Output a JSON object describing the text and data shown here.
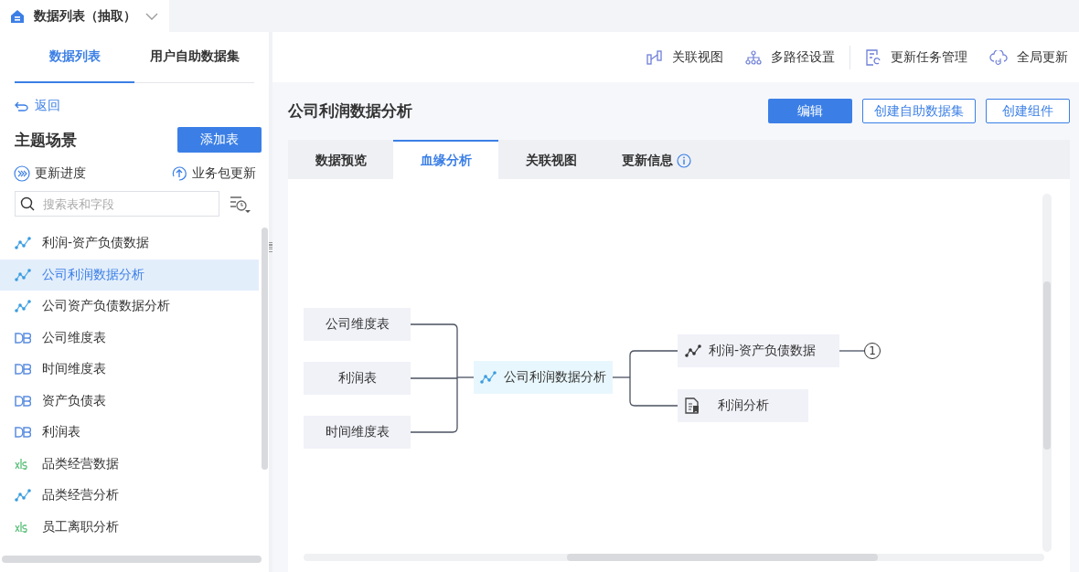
{
  "top_tab": {
    "title": "数据列表（抽取）"
  },
  "sidebar_tabs": [
    {
      "label": "数据列表",
      "selected": true
    },
    {
      "label": "用户自助数据集",
      "selected": false
    }
  ],
  "back": "返回",
  "section_title": "主题场景",
  "add_button": "添加表",
  "update_progress": "更新进度",
  "package_update": "业务包更新",
  "search": {
    "placeholder": "搜索表和字段"
  },
  "items": [
    {
      "label": "利润-资产负债数据",
      "kind": "model",
      "selected": false
    },
    {
      "label": "公司利润数据分析",
      "kind": "model",
      "selected": true
    },
    {
      "label": "公司资产负债数据分析",
      "kind": "model",
      "selected": false
    },
    {
      "label": "公司维度表",
      "kind": "db",
      "selected": false
    },
    {
      "label": "时间维度表",
      "kind": "db",
      "selected": false
    },
    {
      "label": "资产负债表",
      "kind": "db",
      "selected": false
    },
    {
      "label": "利润表",
      "kind": "db",
      "selected": false
    },
    {
      "label": "品类经营数据",
      "kind": "xls",
      "selected": false
    },
    {
      "label": "品类经营分析",
      "kind": "model",
      "selected": false
    },
    {
      "label": "员工离职分析",
      "kind": "xls",
      "selected": false
    }
  ],
  "toolbar": [
    {
      "label": "关联视图",
      "kind": "relation"
    },
    {
      "label": "多路径设置",
      "kind": "tree"
    },
    {
      "label": "更新任务管理",
      "kind": "task"
    },
    {
      "label": "全局更新",
      "kind": "cloud"
    }
  ],
  "page_title": "公司利润数据分析",
  "actions": [
    {
      "label": "编辑",
      "kind": "primary"
    },
    {
      "label": "创建自助数据集",
      "kind": "outline"
    },
    {
      "label": "创建组件",
      "kind": "outline"
    }
  ],
  "content_tabs": [
    {
      "label": "数据预览",
      "selected": false,
      "info": false
    },
    {
      "label": "血缘分析",
      "selected": true,
      "info": false
    },
    {
      "label": "关联视图",
      "selected": false,
      "info": false
    },
    {
      "label": "更新信息",
      "selected": false,
      "info": true
    }
  ],
  "lineage": {
    "sources": [
      {
        "label": "公司维度表"
      },
      {
        "label": "利润表"
      },
      {
        "label": "时间维度表"
      }
    ],
    "center": {
      "label": "公司利润数据分析"
    },
    "targets": [
      {
        "label": "利润-资产负债数据",
        "kind": "model",
        "badge": "1"
      },
      {
        "label": "利润分析",
        "kind": "report"
      }
    ]
  }
}
